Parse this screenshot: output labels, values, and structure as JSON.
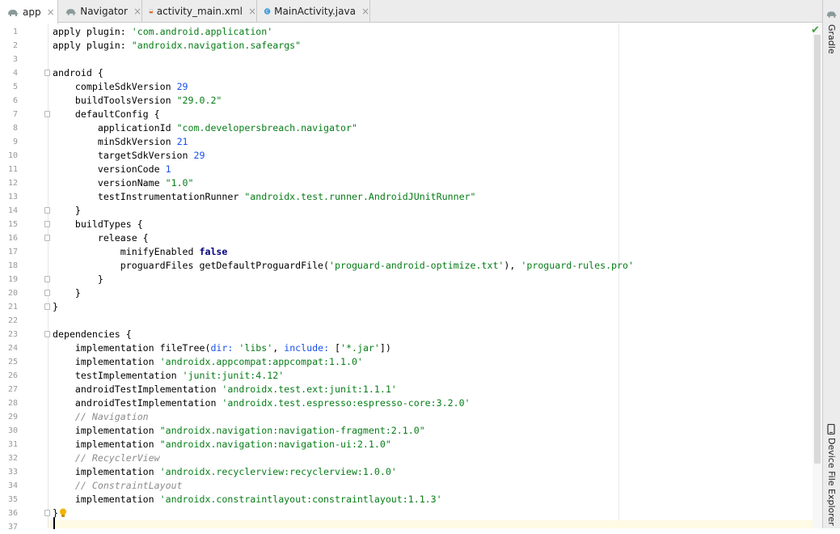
{
  "tabs": [
    {
      "label": "app",
      "icon": "gradle-elephant-icon",
      "active": true
    },
    {
      "label": "Navigator",
      "icon": "gradle-elephant-icon",
      "active": false
    },
    {
      "label": "activity_main.xml",
      "icon": "xml-file-icon",
      "active": false
    },
    {
      "label": "MainActivity.java",
      "icon": "java-class-icon",
      "active": false
    }
  ],
  "close_glyph": "×",
  "right_panel": {
    "gradle": "Gradle",
    "device_explorer": "Device File Explorer"
  },
  "inspection_status": "✔",
  "lines": [
    {
      "n": "1",
      "t": [
        {
          "x": "apply plugin: "
        },
        {
          "x": "'com.android.application'",
          "c": "s"
        }
      ]
    },
    {
      "n": "2",
      "t": [
        {
          "x": "apply plugin: "
        },
        {
          "x": "\"androidx.navigation.safeargs\"",
          "c": "s"
        }
      ]
    },
    {
      "n": "3",
      "t": []
    },
    {
      "n": "4",
      "t": [
        {
          "x": "android {"
        }
      ],
      "fold": true
    },
    {
      "n": "5",
      "t": [
        {
          "x": "    compileSdkVersion "
        },
        {
          "x": "29",
          "c": "n"
        }
      ]
    },
    {
      "n": "6",
      "t": [
        {
          "x": "    buildToolsVersion "
        },
        {
          "x": "\"29.0.2\"",
          "c": "s"
        }
      ]
    },
    {
      "n": "7",
      "t": [
        {
          "x": "    defaultConfig {"
        }
      ],
      "fold": true
    },
    {
      "n": "8",
      "t": [
        {
          "x": "        applicationId "
        },
        {
          "x": "\"com.developersbreach.navigator\"",
          "c": "s"
        }
      ]
    },
    {
      "n": "9",
      "t": [
        {
          "x": "        minSdkVersion "
        },
        {
          "x": "21",
          "c": "n"
        }
      ]
    },
    {
      "n": "10",
      "t": [
        {
          "x": "        targetSdkVersion "
        },
        {
          "x": "29",
          "c": "n"
        }
      ]
    },
    {
      "n": "11",
      "t": [
        {
          "x": "        versionCode "
        },
        {
          "x": "1",
          "c": "n"
        }
      ]
    },
    {
      "n": "12",
      "t": [
        {
          "x": "        versionName "
        },
        {
          "x": "\"1.0\"",
          "c": "s"
        }
      ]
    },
    {
      "n": "13",
      "t": [
        {
          "x": "        testInstrumentationRunner "
        },
        {
          "x": "\"androidx.test.runner.AndroidJUnitRunner\"",
          "c": "s"
        }
      ]
    },
    {
      "n": "14",
      "t": [
        {
          "x": "    }"
        }
      ],
      "fold": true
    },
    {
      "n": "15",
      "t": [
        {
          "x": "    buildTypes {"
        }
      ],
      "fold": true
    },
    {
      "n": "16",
      "t": [
        {
          "x": "        release {"
        }
      ],
      "fold": true
    },
    {
      "n": "17",
      "t": [
        {
          "x": "            minifyEnabled "
        },
        {
          "x": "false",
          "c": "k"
        }
      ]
    },
    {
      "n": "18",
      "t": [
        {
          "x": "            proguardFiles getDefaultProguardFile("
        },
        {
          "x": "'proguard-android-optimize.txt'",
          "c": "s"
        },
        {
          "x": "), "
        },
        {
          "x": "'proguard-rules.pro'",
          "c": "s"
        }
      ]
    },
    {
      "n": "19",
      "t": [
        {
          "x": "        }"
        }
      ],
      "fold": true
    },
    {
      "n": "20",
      "t": [
        {
          "x": "    }"
        }
      ],
      "fold": true
    },
    {
      "n": "21",
      "t": [
        {
          "x": "}"
        }
      ],
      "fold": true
    },
    {
      "n": "22",
      "t": []
    },
    {
      "n": "23",
      "t": [
        {
          "x": "dependencies {"
        }
      ],
      "fold": true
    },
    {
      "n": "24",
      "t": [
        {
          "x": "    implementation fileTree("
        },
        {
          "x": "dir: ",
          "c": "n"
        },
        {
          "x": "'libs'",
          "c": "s"
        },
        {
          "x": ", "
        },
        {
          "x": "include: ",
          "c": "n"
        },
        {
          "x": "["
        },
        {
          "x": "'*.jar'",
          "c": "s"
        },
        {
          "x": "])"
        }
      ]
    },
    {
      "n": "25",
      "t": [
        {
          "x": "    implementation "
        },
        {
          "x": "'androidx.appcompat:appcompat:1.1.0'",
          "c": "s"
        }
      ]
    },
    {
      "n": "26",
      "t": [
        {
          "x": "    testImplementation "
        },
        {
          "x": "'junit:junit:4.12'",
          "c": "s"
        }
      ]
    },
    {
      "n": "27",
      "t": [
        {
          "x": "    androidTestImplementation "
        },
        {
          "x": "'androidx.test.ext:junit:1.1.1'",
          "c": "s"
        }
      ]
    },
    {
      "n": "28",
      "t": [
        {
          "x": "    androidTestImplementation "
        },
        {
          "x": "'androidx.test.espresso:espresso-core:3.2.0'",
          "c": "s"
        }
      ]
    },
    {
      "n": "29",
      "t": [
        {
          "x": "    // Navigation",
          "c": "c"
        }
      ]
    },
    {
      "n": "30",
      "t": [
        {
          "x": "    implementation "
        },
        {
          "x": "\"androidx.navigation:navigation-fragment:2.1.0\"",
          "c": "s"
        }
      ]
    },
    {
      "n": "31",
      "t": [
        {
          "x": "    implementation "
        },
        {
          "x": "\"androidx.navigation:navigation-ui:2.1.0\"",
          "c": "s"
        }
      ]
    },
    {
      "n": "32",
      "t": [
        {
          "x": "    // RecyclerView",
          "c": "c"
        }
      ]
    },
    {
      "n": "33",
      "t": [
        {
          "x": "    implementation "
        },
        {
          "x": "'androidx.recyclerview:recyclerview:1.0.0'",
          "c": "s"
        }
      ]
    },
    {
      "n": "34",
      "t": [
        {
          "x": "    // ConstraintLayout",
          "c": "c"
        }
      ]
    },
    {
      "n": "35",
      "t": [
        {
          "x": "    implementation "
        },
        {
          "x": "'androidx.constraintlayout:constraintlayout:1.1.3'",
          "c": "s"
        }
      ]
    },
    {
      "n": "36",
      "t": [
        {
          "x": "}"
        }
      ],
      "fold": true
    },
    {
      "n": "37",
      "t": [],
      "current": true
    }
  ]
}
